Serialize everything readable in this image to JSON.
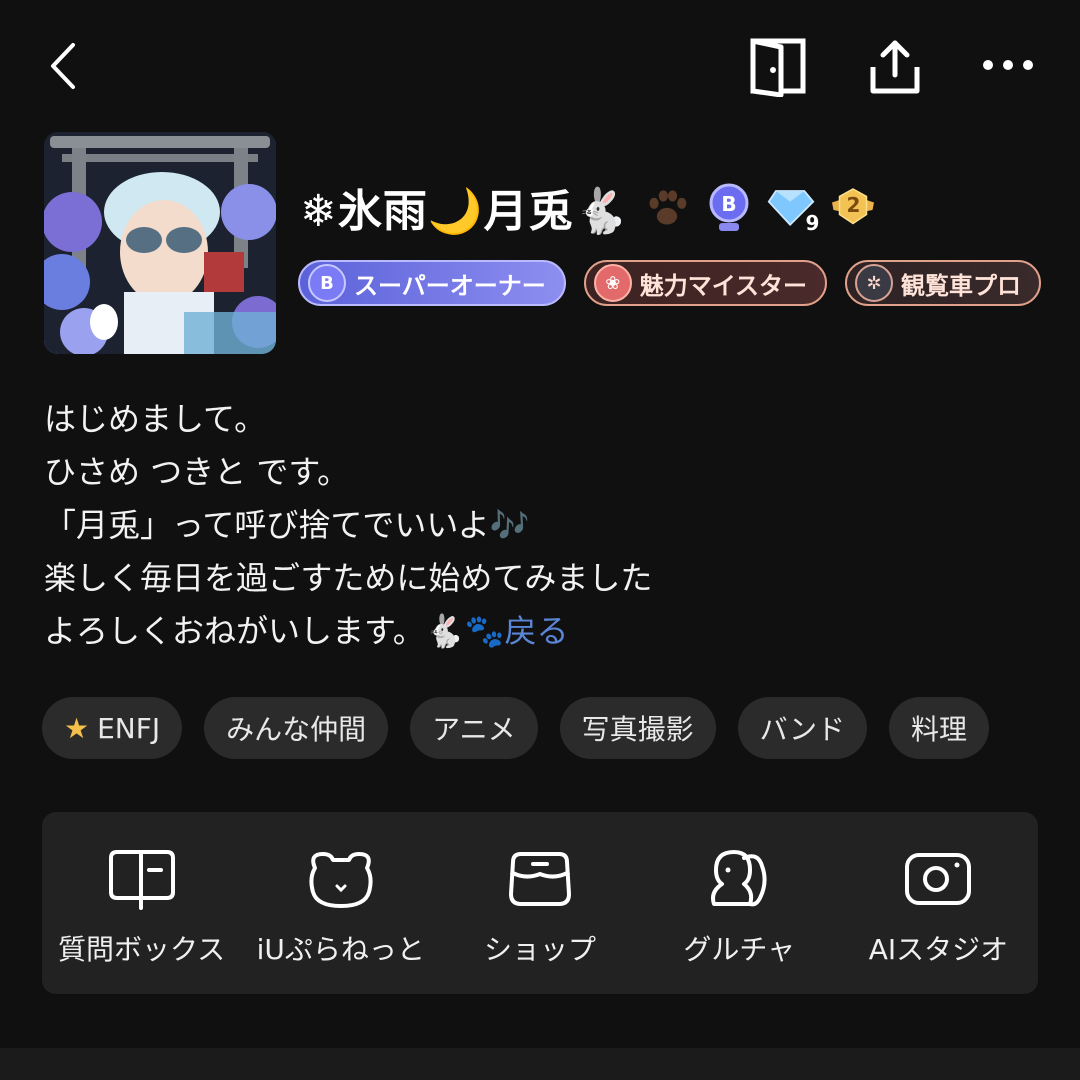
{
  "profile": {
    "name": "❄氷雨🌙月兎🐇",
    "titles": [
      {
        "label": "スーパーオーナー"
      },
      {
        "label": "魅力マイスター"
      },
      {
        "label": "観覧車プロ"
      }
    ],
    "gem_level": "9",
    "rank_badge": "2",
    "bio_lines": [
      "はじめまして。",
      "ひさめ つきと です。",
      "「月兎」って呼び捨てでいいよ🎶",
      "楽しく毎日を過ごすために始めてみました",
      "よろしくおねがいします。🐇🐾"
    ],
    "back_link": "戻る"
  },
  "tags": [
    "ENFJ",
    "みんな仲間",
    "アニメ",
    "写真撮影",
    "バンド",
    "料理"
  ],
  "menu": [
    {
      "label": "質問ボックス",
      "icon": "question-box-icon"
    },
    {
      "label": "iUぷらねっと",
      "icon": "planet-cat-icon"
    },
    {
      "label": "ショップ",
      "icon": "shop-icon"
    },
    {
      "label": "グルチャ",
      "icon": "group-chat-icon"
    },
    {
      "label": "AIスタジオ",
      "icon": "camera-icon"
    }
  ],
  "colors": {
    "background": "#101010",
    "link": "#5b86d6",
    "tag_bg": "#2b2b2b",
    "menu_bg": "#222222"
  }
}
